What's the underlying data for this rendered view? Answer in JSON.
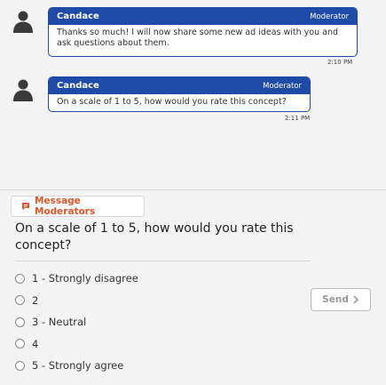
{
  "messages": [
    {
      "sender": "Candace",
      "role": "Moderator",
      "text": "Thanks so much! I will now share some new ad ideas with you and ask questions about them.",
      "time": "2:10 PM"
    },
    {
      "sender": "Candace",
      "role": "Moderator",
      "text": "On a scale of 1 to 5, how would you rate this concept?",
      "time": "2:11 PM"
    }
  ],
  "panel": {
    "message_moderators_label": "Message Moderators",
    "question": "On a scale of 1 to 5, how would you rate this concept?",
    "options": [
      "1 - Strongly disagree",
      "2",
      "3 - Neutral",
      "4",
      "5 - Strongly agree"
    ],
    "send_label": "Send",
    "send_icon": "chevron-right-icon",
    "moderator_icon": "chat-bubble-icon"
  },
  "colors": {
    "accent": "#1f4aa8",
    "moderator_link": "#e0552a"
  }
}
